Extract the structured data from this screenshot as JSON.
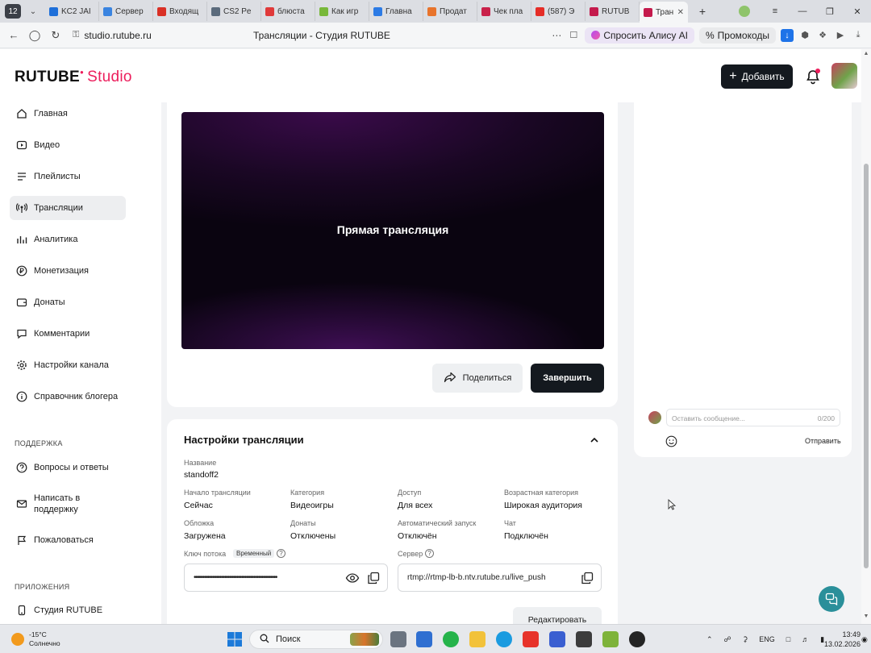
{
  "browser": {
    "tab_counter": "12",
    "tabs": [
      {
        "label": "KC2 JAI",
        "color": "#1e6fd9"
      },
      {
        "label": "Сервер",
        "color": "#3a84e0"
      },
      {
        "label": "Входящ",
        "color": "#d93025"
      },
      {
        "label": "CS2 Pe",
        "color": "#5b6b7c"
      },
      {
        "label": "блюста",
        "color": "#e03a3a"
      },
      {
        "label": "Как игр",
        "color": "#78b83a"
      },
      {
        "label": "Главна",
        "color": "#2c7be5"
      },
      {
        "label": "Продат",
        "color": "#e8742c"
      },
      {
        "label": "Чек пла",
        "color": "#c9214a"
      },
      {
        "label": "(587) Э",
        "color": "#e52d27"
      },
      {
        "label": "RUTUB",
        "color": "#c41a4c"
      }
    ],
    "active_tab": {
      "label": "Тран",
      "color": "#c41a4c"
    },
    "url": "studio.rutube.ru",
    "page_title": "Трансляции - Студия RUTUBE",
    "alice_label": "Спросить Алису AI",
    "promo_label": "Промокоды"
  },
  "header": {
    "logo_main": "RUTUBE",
    "logo_studio": "Studio",
    "add_label": "Добавить"
  },
  "sidebar": {
    "items": [
      {
        "label": "Главная"
      },
      {
        "label": "Видео"
      },
      {
        "label": "Плейлисты"
      },
      {
        "label": "Трансляции"
      },
      {
        "label": "Аналитика"
      },
      {
        "label": "Монетизация"
      },
      {
        "label": "Донаты"
      },
      {
        "label": "Комментарии"
      },
      {
        "label": "Настройки канала"
      },
      {
        "label": "Справочник блогера"
      }
    ],
    "support_title": "ПОДДЕРЖКА",
    "support_items": [
      {
        "label": "Вопросы и ответы"
      },
      {
        "label": "Написать в поддержку"
      },
      {
        "label": "Пожаловаться"
      }
    ],
    "apps_title": "ПРИЛОЖЕНИЯ",
    "apps_items": [
      {
        "label": "Студия RUTUBE"
      }
    ]
  },
  "player": {
    "label": "Прямая трансляция",
    "share_label": "Поделиться",
    "end_label": "Завершить"
  },
  "settings": {
    "title": "Настройки трансляции",
    "name_label": "Название",
    "name_value": "standoff2",
    "start_label": "Начало трансляции",
    "start_value": "Сейчас",
    "category_label": "Категория",
    "category_value": "Видеоигры",
    "access_label": "Доступ",
    "access_value": "Для всех",
    "age_label": "Возрастная категория",
    "age_value": "Широкая аудитория",
    "cover_label": "Обложка",
    "cover_value": "Загружена",
    "donate_label": "Донаты",
    "donate_value": "Отключены",
    "autostart_label": "Автоматический запуск",
    "autostart_value": "Отключён",
    "chat_label": "Чат",
    "chat_value": "Подключён",
    "key_label": "Ключ потока",
    "key_badge": "Временный",
    "key_mask": "•••••••••••••••••••••••••••••••••••••••••••••••••",
    "server_label": "Сервер",
    "server_value": "rtmp://rtmp-lb-b.ntv.rutube.ru/live_push",
    "edit_label": "Редактировать"
  },
  "chat": {
    "placeholder": "Оставить сообщение...",
    "counter": "0/200",
    "send_label": "Отправить"
  },
  "taskbar": {
    "temp": "-15°C",
    "weather": "Солнечно",
    "search_label": "Поиск",
    "lang": "ENG",
    "time": "13:49",
    "date": "13.02.2026"
  },
  "colors": {
    "accent": "#ec1e5c",
    "dark_button": "#14191f",
    "support_fab": "#2a8f9a"
  }
}
